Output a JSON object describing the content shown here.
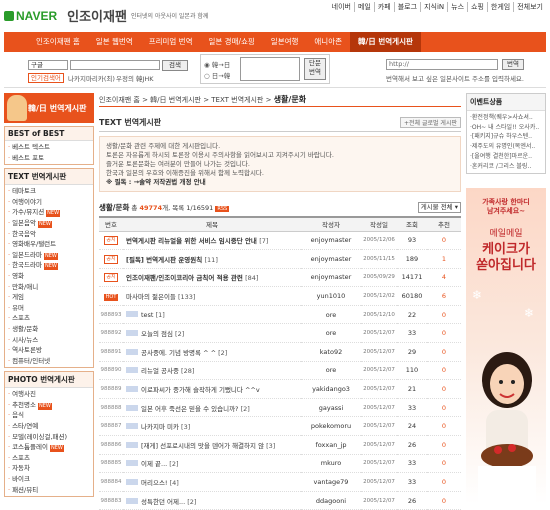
{
  "brand": {
    "logo": "NAVER",
    "title": "인조이재팬",
    "tag": "인터넷의 아웃사이 일본과 함께"
  },
  "toplinks": [
    "네이버",
    "메일",
    "카페",
    "블로그",
    "지식iN",
    "뉴스",
    "쇼핑",
    "한게임",
    "전체보기"
  ],
  "nav": {
    "items": [
      "인조이재팬 홈",
      "일본 웹번역",
      "프리미엄 번역",
      "일본 경매/쇼핑",
      "일본여행",
      "애니아존"
    ],
    "active": "韓/日 번역게시판"
  },
  "translator": {
    "select1": "구글",
    "btn1": "검색",
    "link1": "인기검색어",
    "link2": "나카지마리카(최)",
    "link3": "우정의 韓JHK",
    "radio1": "韓→日",
    "radio2": "日→韓",
    "btn2": "단문번역",
    "url_placeholder": "http://",
    "btn3": "번역",
    "note": "번역해서 보고 싶은 일본사이트 주소를 입력하세요."
  },
  "sidebar": {
    "head": "韓/日 번역게시판",
    "best": {
      "title": "BEST of BEST",
      "items": [
        "베스트 텍스트",
        "베스트 포토"
      ]
    },
    "text": {
      "title": "TEXT 번역게시판",
      "items": [
        "테마토크",
        "여행이야기",
        "가수/뮤지션",
        "일본음악",
        "한국음악",
        "영화배우/탤런트",
        "일본드라마",
        "한국드라마",
        "영화",
        "만화/애니",
        "게임",
        "유머",
        "스포츠",
        "생활/문화",
        "시사/뉴스",
        "역사토론방",
        "컴퓨터/인터넷"
      ],
      "new_items": [
        "가수/뮤지션",
        "일본음악",
        "일본드라마",
        "한국드라마"
      ]
    },
    "photo": {
      "title": "PHOTO 번역게시판",
      "items": [
        "여행사진",
        "추천명소",
        "음식",
        "스타/연예",
        "모델(레이싱걸,패션)",
        "코스튬플레이",
        "스포츠",
        "자동차",
        "바이크",
        "패션/뷰티"
      ],
      "new_items": [
        "추천명소",
        "코스튬플레이"
      ]
    },
    "badge": "NEW"
  },
  "main": {
    "crumb": "인조이재팬 홈 > 韓/日 번역게시판 > TEXT 번역게시판 >",
    "crumb_current": "생활/문화",
    "box_title": "TEXT 번역게시판",
    "tag": "+전체 글로벌 게시판",
    "notice": [
      "생활/문화 관련 주제에 대한 게시판입니다.",
      "토론은 자유롭게 하시되 토론장 이용시 주의사항을 읽어보시고 지켜주시기 바랍니다.",
      "즐거운 토론문화는 여러분이 만들어 나가는 것입니다.",
      "한국과 일본의 우호와 이해증진을 위해서 함께 노력합시다."
    ],
    "warn": "※ 필독 : →솔약 저작권법 개정 안내",
    "board_label": "생활/문화",
    "count_prefix": "총",
    "count": "49774",
    "count_suffix": "개, 목록",
    "pages": "1/16591",
    "rss": "RSS",
    "filter": "게시물 전체",
    "columns": [
      "번호",
      "제목",
      "작성자",
      "작성일",
      "조회",
      "추천"
    ],
    "rows": [
      {
        "no": "공지",
        "type": "pin",
        "title": "번역게시판 리뉴얼을 위한 서비스 임시중단 안내",
        "cm": "[7]",
        "author": "enjoymaster",
        "date": "2005/12/06",
        "views": "93",
        "rec": "0",
        "bold": true
      },
      {
        "no": "공지",
        "type": "pin",
        "title": "[필독] 번역게시판 운영원칙",
        "cm": "[11]",
        "author": "enjoymaster",
        "date": "2005/11/15",
        "views": "189",
        "rec": "1",
        "bold": true
      },
      {
        "no": "공지",
        "type": "pin",
        "title": "인조이재팬/인조이코리아 금칙어 적용 관련",
        "cm": "[84]",
        "author": "enjoymaster",
        "date": "2005/09/29",
        "views": "14171",
        "rec": "4",
        "bold": true
      },
      {
        "no": "HOT",
        "type": "hot",
        "title": "마사마의 젊은이들",
        "cm": "[133]",
        "author": "yun1010",
        "date": "2005/12/02",
        "views": "60180",
        "rec": "6",
        "bold": false
      },
      {
        "no": "988893",
        "type": "ico",
        "title": "test",
        "cm": "[1]",
        "author": "ore",
        "date": "2005/12/10",
        "views": "22",
        "rec": "0",
        "bold": false
      },
      {
        "no": "988892",
        "type": "ico",
        "title": "오늘의 점심",
        "cm": "[2]",
        "author": "ore",
        "date": "2005/12/07",
        "views": "33",
        "rec": "0",
        "bold": false
      },
      {
        "no": "988891",
        "type": "ico",
        "title": "공사중에. 기념 방명록 ^ ^",
        "cm": "[2]",
        "author": "kato92",
        "date": "2005/12/07",
        "views": "29",
        "rec": "0",
        "bold": false
      },
      {
        "no": "988890",
        "type": "ico",
        "title": "리뉴얼 공사중",
        "cm": "[28]",
        "author": "ore",
        "date": "2005/12/07",
        "views": "110",
        "rec": "0",
        "bold": false
      },
      {
        "no": "988889",
        "type": "ico",
        "title": "이로파씨가 중가해 슬작하게 기뻤니다 ^^v",
        "cm": "",
        "author": "yakidango3",
        "date": "2005/12/07",
        "views": "21",
        "rec": "0",
        "bold": false
      },
      {
        "no": "988888",
        "type": "ico",
        "title": "일본 어후 죽선은 믿을 수 있습니까?",
        "cm": "[2]",
        "author": "gayassi",
        "date": "2005/12/07",
        "views": "33",
        "rec": "0",
        "bold": false
      },
      {
        "no": "988887",
        "type": "ico",
        "title": "나카지마 미카",
        "cm": "[3]",
        "author": "pokekomoru",
        "date": "2005/12/07",
        "views": "24",
        "rec": "0",
        "bold": false
      },
      {
        "no": "988886",
        "type": "ico",
        "title": "[재게] 선포로시내의 맛을 덴어가 해결하지 않",
        "cm": "[3]",
        "author": "foxxan_jp",
        "date": "2005/12/07",
        "views": "26",
        "rec": "0",
        "bold": false
      },
      {
        "no": "988885",
        "type": "ico",
        "title": "이제 끝...",
        "cm": "[2]",
        "author": "mkuro",
        "date": "2005/12/07",
        "views": "33",
        "rec": "0",
        "bold": false
      },
      {
        "no": "988884",
        "type": "ico",
        "title": "머리으스!",
        "cm": "[4]",
        "author": "vantage79",
        "date": "2005/12/07",
        "views": "33",
        "rec": "0",
        "bold": false
      },
      {
        "no": "988883",
        "type": "ico",
        "title": "성특한던 어제...",
        "cm": "[2]",
        "author": "ddagooni",
        "date": "2005/12/07",
        "views": "26",
        "rec": "0",
        "bold": false
      }
    ]
  },
  "right": {
    "title": "이벤트상품",
    "items": [
      "·환전정책(퀘우>사쇼셔..",
      "·OH~ 내 스타일!! 오사카..",
      "·[패키지]규슈 하우스텐..",
      "·제주도의 유명인(목엔서..",
      "·[올여행 결천한]마르운..",
      "·혼커리코 /그리스 블링.."
    ],
    "ad": {
      "l1": "가족사랑 한마디",
      "l1b": "남겨주세요~",
      "l2": "메일메일",
      "l3a": "케이크가",
      "l3b": "쏟아집니다"
    }
  }
}
